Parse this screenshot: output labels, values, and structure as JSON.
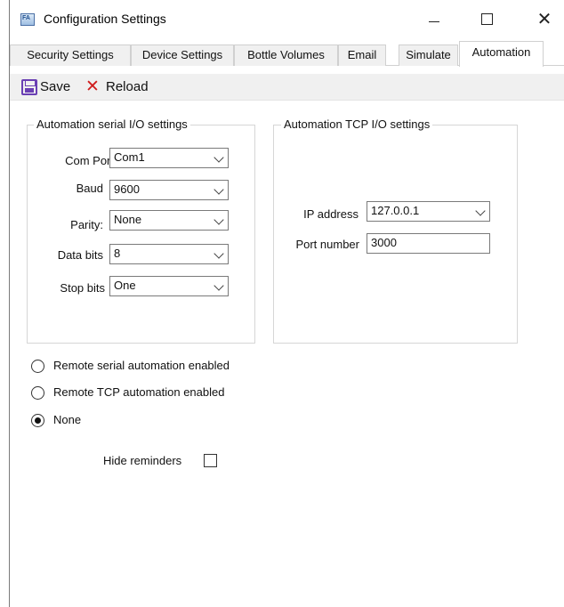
{
  "window": {
    "title": "Configuration Settings",
    "icon": "app-icon",
    "icon_text": "FA",
    "minimize_symbol": "",
    "maximize_symbol": "",
    "close_symbol": "✕"
  },
  "tabs": [
    {
      "label": "Security Settings",
      "active": false
    },
    {
      "label": "Device Settings",
      "active": false
    },
    {
      "label": "Bottle Volumes",
      "active": false
    },
    {
      "label": "Email",
      "active": false
    },
    {
      "label": "Simulate",
      "active": false
    },
    {
      "label": "Automation",
      "active": true
    }
  ],
  "toolbar": {
    "save_label": "Save",
    "save_icon": "save-icon",
    "reload_label": "Reload",
    "reload_icon": "x-icon",
    "reload_symbol": "✕",
    "reload_color": "#d01c1c",
    "save_color": "#6a3fb3"
  },
  "serial": {
    "title": "Automation serial I/O settings",
    "com_port": {
      "label": "Com Port",
      "value": "Com1"
    },
    "baud": {
      "label": "Baud",
      "value": "9600"
    },
    "parity": {
      "label": "Parity:",
      "value": "None"
    },
    "data_bits": {
      "label": "Data bits",
      "value": "8"
    },
    "stop_bits": {
      "label": "Stop bits",
      "value": "One"
    }
  },
  "tcp": {
    "title": "Automation TCP I/O settings",
    "ip_address": {
      "label": "IP address",
      "value": "127.0.0.1"
    },
    "port_number": {
      "label": "Port number",
      "value": "3000"
    }
  },
  "automation_mode": {
    "options": [
      {
        "label": "Remote serial automation enabled",
        "selected": false
      },
      {
        "label": "Remote TCP automation enabled",
        "selected": false
      },
      {
        "label": "None",
        "selected": true
      }
    ]
  },
  "hide_reminders": {
    "label": "Hide reminders",
    "checked": false
  }
}
